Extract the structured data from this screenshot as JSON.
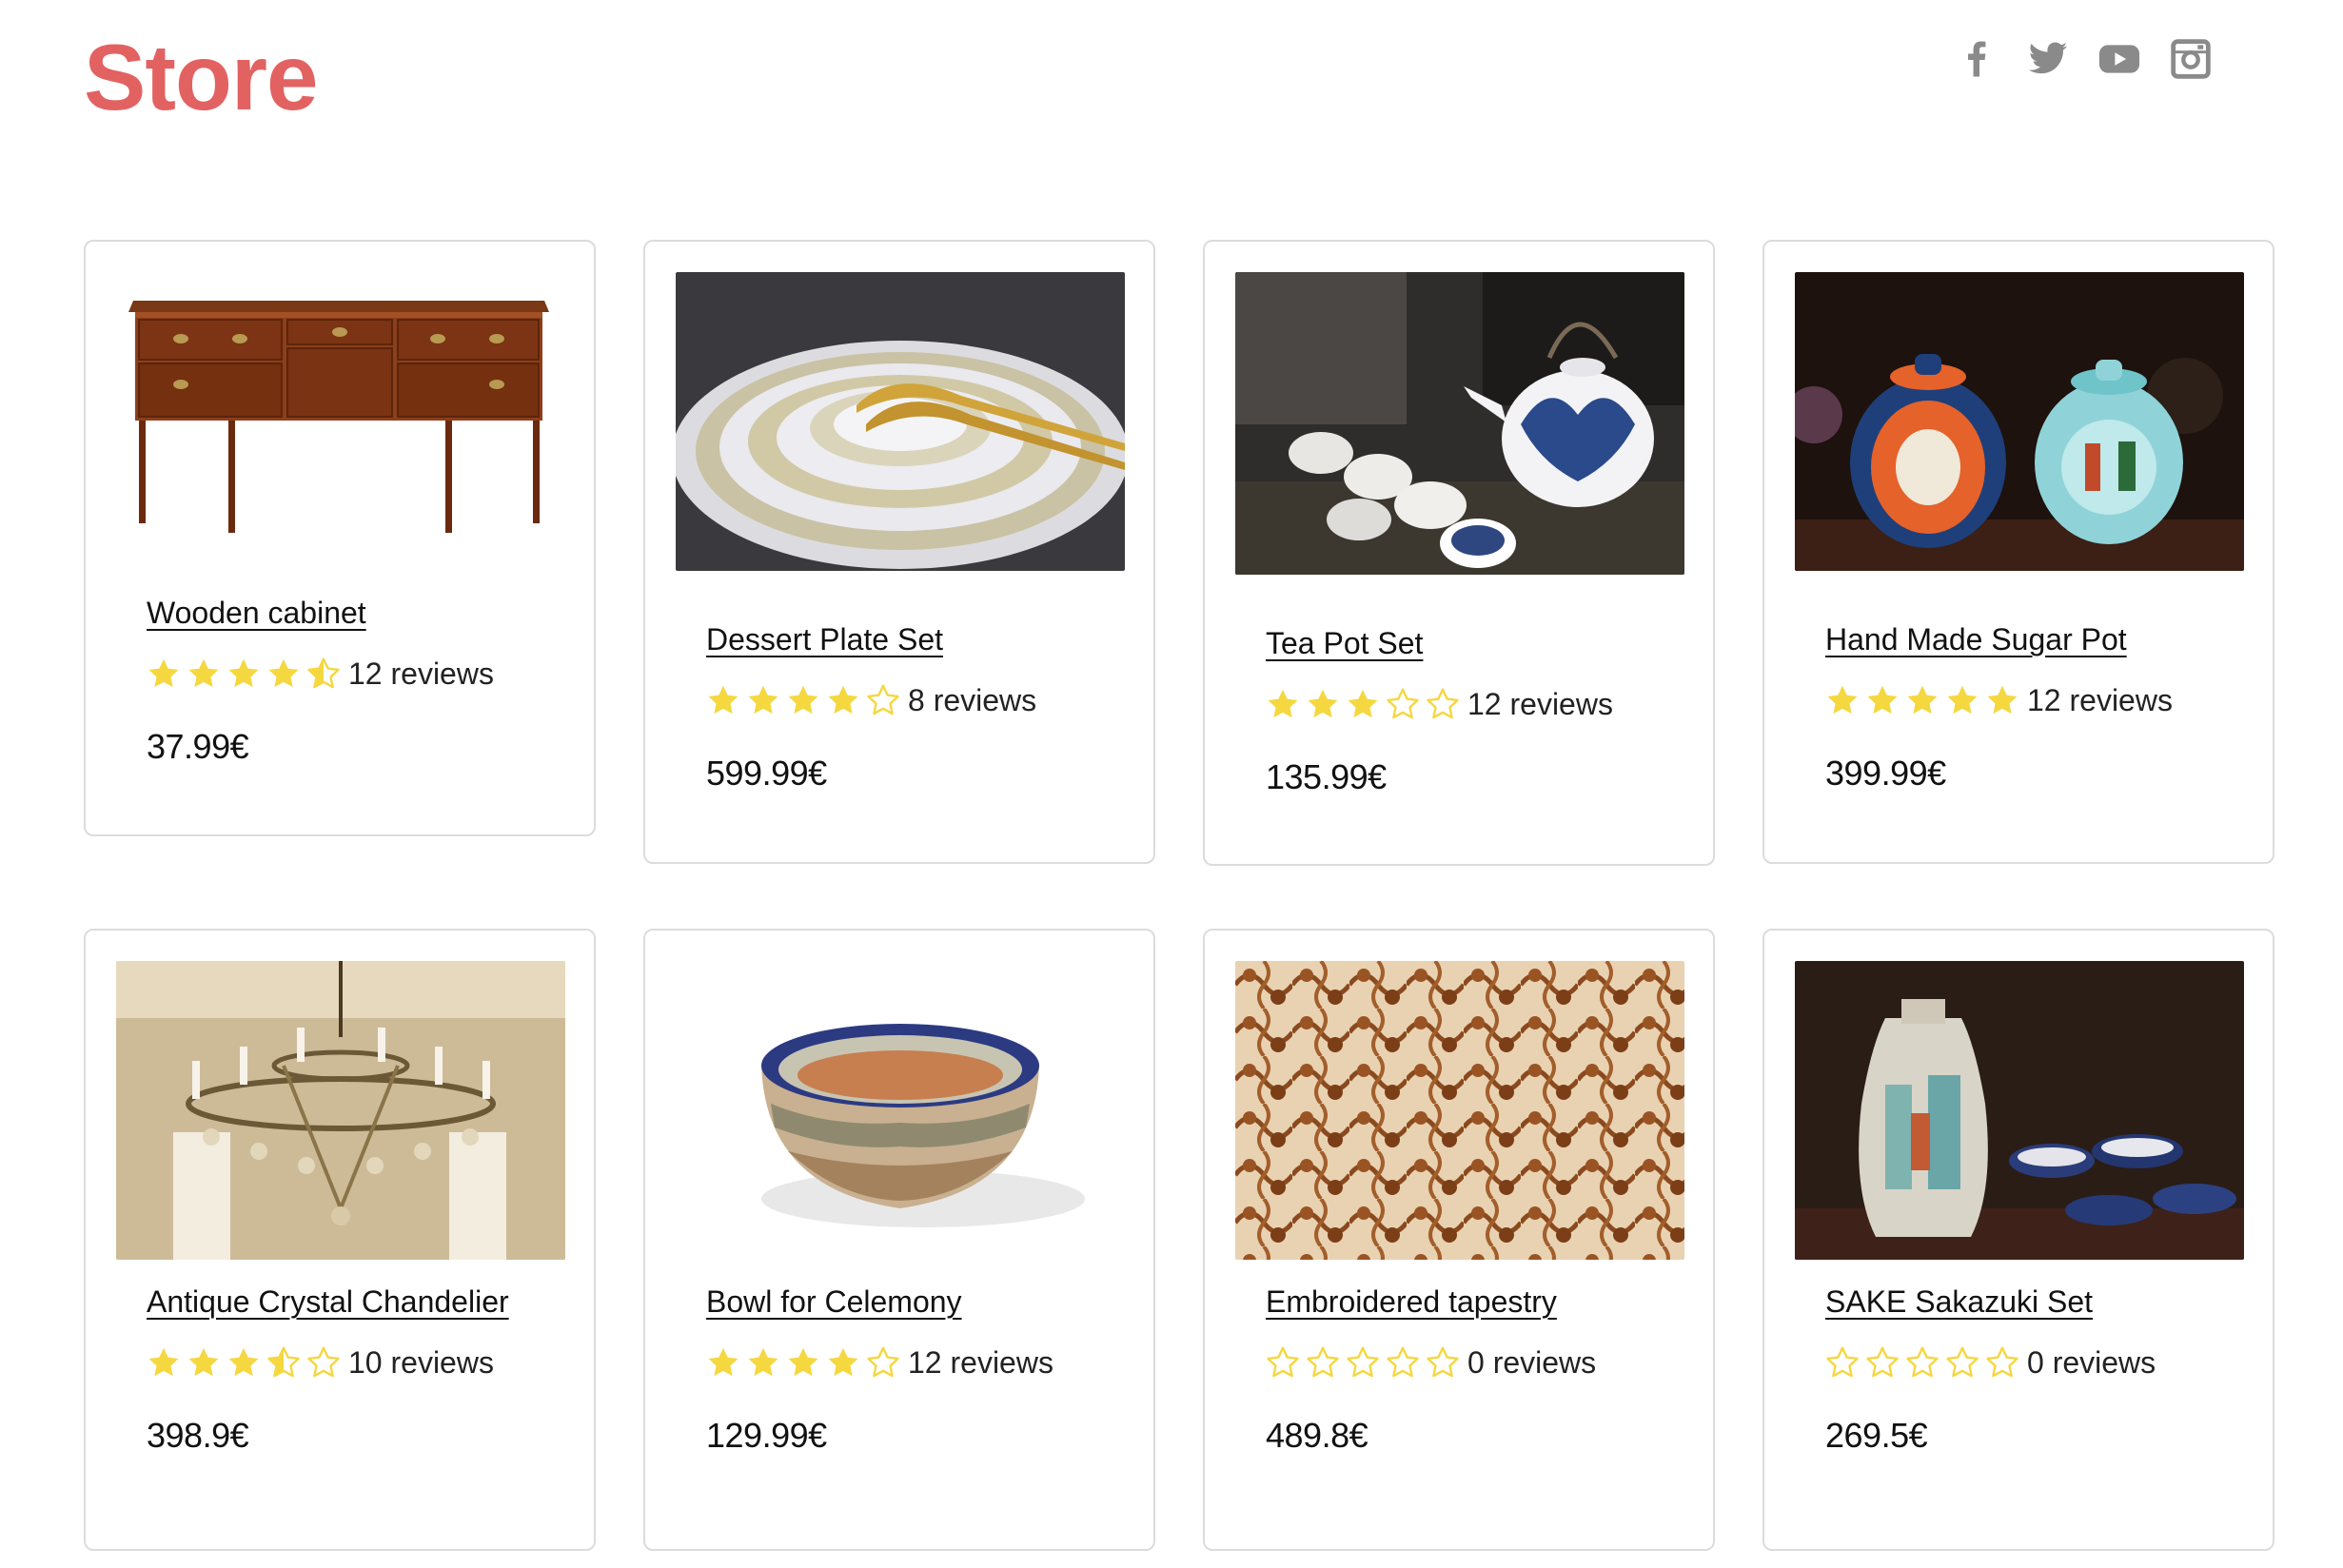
{
  "header": {
    "title": "Store",
    "title_color": "#e26262",
    "social": [
      {
        "name": "facebook-icon"
      },
      {
        "name": "twitter-icon"
      },
      {
        "name": "youtube-icon"
      },
      {
        "name": "instagram-icon"
      }
    ]
  },
  "accent": {
    "star_fill": "#f5d740",
    "star_outline": "#f5d740",
    "icon_gray": "#8a8a8a"
  },
  "products": [
    {
      "title": "Wooden cabinet",
      "rating": 4.5,
      "reviews": "12 reviews",
      "price": "37.99€",
      "image": "wooden-cabinet-image"
    },
    {
      "title": "Dessert Plate Set",
      "rating": 4,
      "reviews": "8 reviews",
      "price": "599.99€",
      "image": "dessert-plate-image"
    },
    {
      "title": "Tea Pot Set",
      "rating": 3,
      "reviews": "12 reviews",
      "price": "135.99€",
      "image": "tea-pot-image"
    },
    {
      "title": "Hand Made Sugar Pot",
      "rating": 5,
      "reviews": "12 reviews",
      "price": "399.99€",
      "image": "sugar-pot-image"
    },
    {
      "title": "Antique Crystal Chandelier",
      "rating": 3.5,
      "reviews": "10 reviews",
      "price": "398.9€",
      "image": "chandelier-image"
    },
    {
      "title": "Bowl for Celemony",
      "rating": 4,
      "reviews": "12 reviews",
      "price": "129.99€",
      "image": "bowl-image"
    },
    {
      "title": "Embroidered tapestry",
      "rating": 0,
      "reviews": "0 reviews",
      "price": "489.8€",
      "image": "tapestry-image"
    },
    {
      "title": "SAKE Sakazuki Set",
      "rating": 0,
      "reviews": "0 reviews",
      "price": "269.5€",
      "image": "sake-set-image"
    }
  ]
}
